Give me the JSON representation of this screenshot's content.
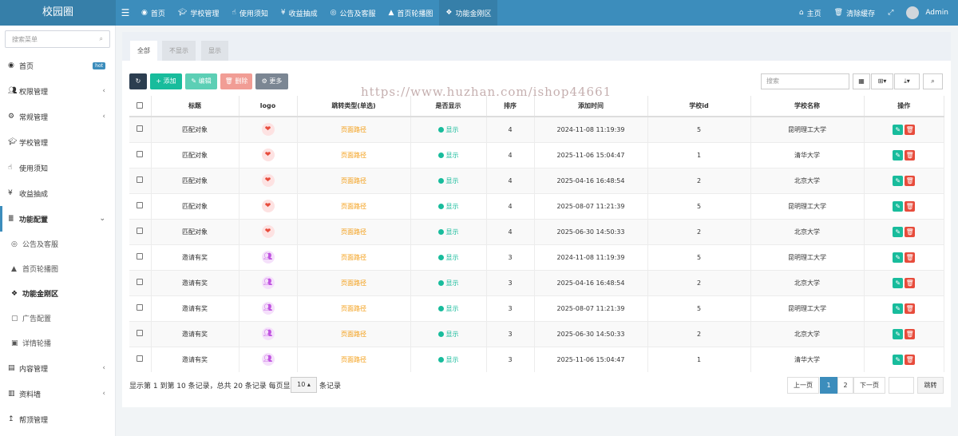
{
  "app": {
    "logo": "校园圈"
  },
  "topnav": [
    {
      "icon": "dashboard-icon",
      "label": "首页"
    },
    {
      "icon": "graduation-cap-icon",
      "label": "学校管理"
    },
    {
      "icon": "hand-pointer-icon",
      "label": "使用须知"
    },
    {
      "icon": "yen-icon",
      "label": "收益抽成"
    },
    {
      "icon": "user-circle-icon",
      "label": "公告及客服"
    },
    {
      "icon": "area-chart-icon",
      "label": "首页轮播图"
    },
    {
      "icon": "cubes-icon",
      "label": "功能金刚区"
    }
  ],
  "topright": {
    "home": "主页",
    "clear_cache": "清除缓存",
    "user": "Admin"
  },
  "sidebar": {
    "search_placeholder": "搜索菜单",
    "items": [
      {
        "label": "首页",
        "badge": "hot"
      },
      {
        "label": "权限管理"
      },
      {
        "label": "常规管理"
      },
      {
        "label": "学校管理"
      },
      {
        "label": "使用须知"
      },
      {
        "label": "收益抽成"
      },
      {
        "label": "功能配置"
      }
    ],
    "sub_items": [
      {
        "label": "公告及客服"
      },
      {
        "label": "首页轮播图"
      },
      {
        "label": "功能金刚区"
      },
      {
        "label": "广告配置"
      },
      {
        "label": "详情轮播"
      }
    ],
    "bottom_items": [
      {
        "label": "内容管理"
      },
      {
        "label": "资料墙"
      },
      {
        "label": "帮顶管理"
      }
    ]
  },
  "tabs": [
    "全部",
    "不显示",
    "显示"
  ],
  "toolbar": {
    "add": "添加",
    "edit": "编辑",
    "delete": "删除",
    "more": "更多",
    "search_placeholder": "搜索"
  },
  "watermark": "https://www.huzhan.com/ishop44661",
  "table": {
    "headers": [
      "标题",
      "logo",
      "跳转类型(单选)",
      "是否显示",
      "排序",
      "添加时间",
      "学校id",
      "学校名称",
      "操作"
    ],
    "rows": [
      {
        "title": "匹配对象",
        "logo": "heart",
        "jump": "页面路径",
        "show": "显示",
        "sort": "4",
        "time": "2024-11-08 11:19:39",
        "school_id": "5",
        "school": "昆明理工大学"
      },
      {
        "title": "匹配对象",
        "logo": "heart",
        "jump": "页面路径",
        "show": "显示",
        "sort": "4",
        "time": "2025-11-06 15:04:47",
        "school_id": "1",
        "school": "清华大学"
      },
      {
        "title": "匹配对象",
        "logo": "heart",
        "jump": "页面路径",
        "show": "显示",
        "sort": "4",
        "time": "2025-04-16 16:48:54",
        "school_id": "2",
        "school": "北京大学"
      },
      {
        "title": "匹配对象",
        "logo": "heart",
        "jump": "页面路径",
        "show": "显示",
        "sort": "4",
        "time": "2025-08-07 11:21:39",
        "school_id": "5",
        "school": "昆明理工大学"
      },
      {
        "title": "匹配对象",
        "logo": "heart",
        "jump": "页面路径",
        "show": "显示",
        "sort": "4",
        "time": "2025-06-30 14:50:33",
        "school_id": "2",
        "school": "北京大学"
      },
      {
        "title": "邀请有奖",
        "logo": "user",
        "jump": "页面路径",
        "show": "显示",
        "sort": "3",
        "time": "2024-11-08 11:19:39",
        "school_id": "5",
        "school": "昆明理工大学"
      },
      {
        "title": "邀请有奖",
        "logo": "user",
        "jump": "页面路径",
        "show": "显示",
        "sort": "3",
        "time": "2025-04-16 16:48:54",
        "school_id": "2",
        "school": "北京大学"
      },
      {
        "title": "邀请有奖",
        "logo": "user",
        "jump": "页面路径",
        "show": "显示",
        "sort": "3",
        "time": "2025-08-07 11:21:39",
        "school_id": "5",
        "school": "昆明理工大学"
      },
      {
        "title": "邀请有奖",
        "logo": "user",
        "jump": "页面路径",
        "show": "显示",
        "sort": "3",
        "time": "2025-06-30 14:50:33",
        "school_id": "2",
        "school": "北京大学"
      },
      {
        "title": "邀请有奖",
        "logo": "user",
        "jump": "页面路径",
        "show": "显示",
        "sort": "3",
        "time": "2025-11-06 15:04:47",
        "school_id": "1",
        "school": "清华大学"
      }
    ]
  },
  "pagination": {
    "summary": "显示第 1 到第 10 条记录，总共 20 条记录 每页显示",
    "page_size": "10",
    "suffix": "条记录",
    "prev": "上一页",
    "pages": [
      "1",
      "2"
    ],
    "next": "下一页",
    "jump": "跳转"
  },
  "colors": {
    "topbar": "#3c8dbc",
    "add": "#18bc9c",
    "edit": "#5ccfb5",
    "delete": "#f19d95",
    "more": "#7b8693",
    "refresh": "#2c3e50",
    "danger": "#e74c3c",
    "link": "#f39c12"
  }
}
